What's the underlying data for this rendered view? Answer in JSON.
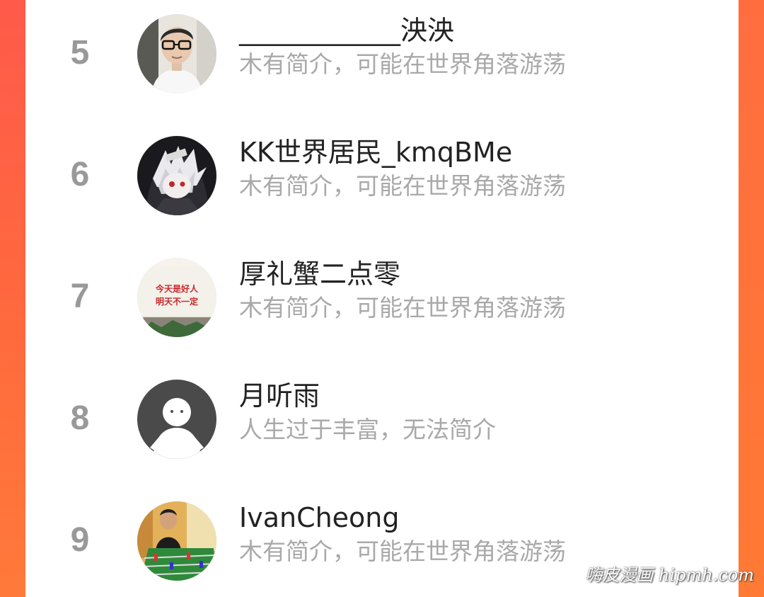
{
  "users": [
    {
      "rank": "5",
      "name": "____________泱泱",
      "bio": "木有简介，可能在世界角落游荡",
      "avatar": "photo-avatar-glasses-person"
    },
    {
      "rank": "6",
      "name": "KK世界居民_kmqBMe",
      "bio": "木有简介，可能在世界角落游荡",
      "avatar": "anime-character-avatar"
    },
    {
      "rank": "7",
      "name": "厚礼蟹二点零",
      "bio": "木有简介，可能在世界角落游荡",
      "avatar": "text-sign-avatar",
      "avatar_text_line1": "今天是好人",
      "avatar_text_line2": "明天不一定"
    },
    {
      "rank": "8",
      "name": "月听雨",
      "bio": "人生过于丰富，无法简介",
      "avatar": "default-avatar"
    },
    {
      "rank": "9",
      "name": "IvanCheong",
      "bio": "木有简介，可能在世界角落游荡",
      "avatar": "photo-avatar-foosball"
    }
  ],
  "watermark": "嗨皮漫画 hipmh.com",
  "colors": {
    "background_left": "#ff5a4a",
    "background_right": "#ff7a34",
    "rank": "#999999",
    "name": "#222222",
    "bio": "#a9a9a9"
  }
}
